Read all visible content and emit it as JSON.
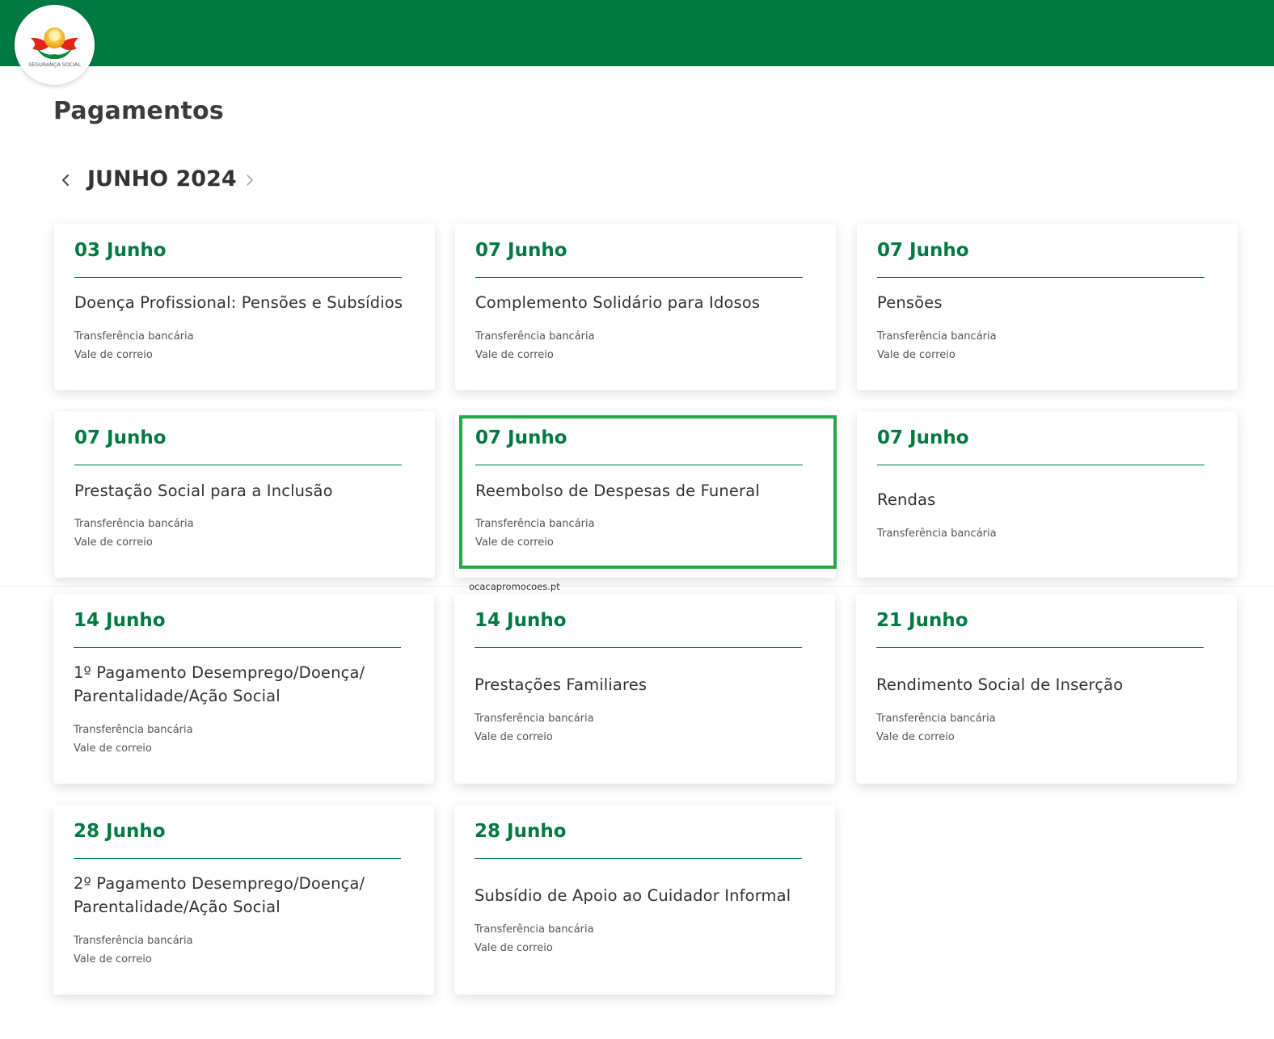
{
  "header": {
    "bar_color": "#007a42",
    "logo": {
      "name": "seguranca-social-logo",
      "text": "SEGURANÇA SOCIAL"
    }
  },
  "page": {
    "title": "Pagamentos"
  },
  "month_nav": {
    "label": "JUNHO 2024",
    "prev_icon": "chevron-left-icon",
    "next_icon": "chevron-right-icon"
  },
  "colors": {
    "accent_green": "#007a42",
    "highlight_border": "#26a84a",
    "heading_text": "#333333",
    "muted_text": "#555555"
  },
  "cards": [
    {
      "date": "03 Junho",
      "title": "Doença Profissional: Pensões e Subsídios",
      "methods": [
        "Transferência bancária",
        "Vale de correio"
      ]
    },
    {
      "date": "07 Junho",
      "title": "Complemento Solidário para Idosos",
      "methods": [
        "Transferência bancária",
        "Vale de correio"
      ]
    },
    {
      "date": "07 Junho",
      "title": "Pensões",
      "methods": [
        "Transferência bancária",
        "Vale de correio"
      ]
    },
    {
      "date": "07 Junho",
      "title": "Prestação Social para a Inclusão",
      "methods": [
        "Transferência bancária",
        "Vale de correio"
      ]
    },
    {
      "date": "07 Junho",
      "title": "Reembolso de Despesas de Funeral",
      "methods": [
        "Transferência bancária",
        "Vale de correio"
      ],
      "highlighted": true
    },
    {
      "date": "07 Junho",
      "title": "Rendas",
      "methods": [
        "Transferência bancária"
      ]
    },
    {
      "date": "14 Junho",
      "title_lines": [
        "1º Pagamento Desemprego/Doença/",
        "Parentalidade/Ação Social"
      ],
      "methods": [
        "Transferência bancária",
        "Vale de correio"
      ]
    },
    {
      "date": "14 Junho",
      "title": "Prestações Familiares",
      "methods": [
        "Transferência bancária",
        "Vale de correio"
      ]
    },
    {
      "date": "21 Junho",
      "title": "Rendimento Social de Inserção",
      "methods": [
        "Transferência bancária",
        "Vale de correio"
      ]
    },
    {
      "date": "28 Junho",
      "title_lines": [
        "2º Pagamento Desemprego/Doença/",
        "Parentalidade/Ação Social"
      ],
      "methods": [
        "Transferência bancária",
        "Vale de correio"
      ]
    },
    {
      "date": "28 Junho",
      "title": "Subsídio de Apoio ao Cuidador Informal",
      "methods": [
        "Transferência bancária",
        "Vale de correio"
      ]
    }
  ],
  "watermark": "ocacapromocoes.pt"
}
